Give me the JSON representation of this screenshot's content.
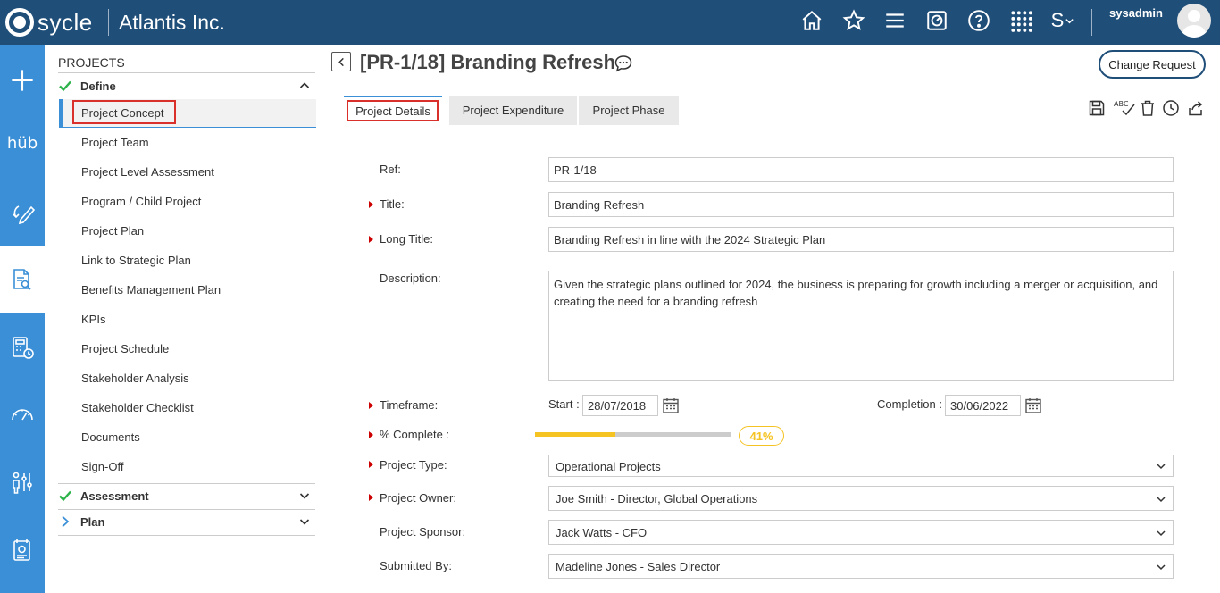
{
  "header": {
    "logo_text": "sycle",
    "company": "Atlantis Inc.",
    "username": "sysadmin",
    "user_initial": "S"
  },
  "sidebar": {
    "title": "PROJECTS",
    "sections": [
      {
        "label": "Define",
        "status": "complete",
        "expanded": true
      },
      {
        "label": "Assessment",
        "status": "complete",
        "expanded": false
      },
      {
        "label": "Plan",
        "status": "pending",
        "expanded": false
      }
    ],
    "define_items": [
      "Project Concept",
      "Project Team",
      "Project Level Assessment",
      "Program / Child Project",
      "Project Plan",
      "Link to Strategic Plan",
      "Benefits Management Plan",
      "KPIs",
      "Project Schedule",
      "Stakeholder Analysis",
      "Stakeholder Checklist",
      "Documents",
      "Sign-Off"
    ],
    "active_item": "Project Concept"
  },
  "main": {
    "title": "[PR-1/18] Branding Refresh",
    "change_request_label": "Change Request",
    "tabs": [
      {
        "label": "Project Details",
        "active": true
      },
      {
        "label": "Project Expenditure",
        "active": false
      },
      {
        "label": "Project Phase",
        "active": false
      }
    ],
    "form": {
      "ref_label": "Ref:",
      "ref_value": "PR-1/18",
      "title_label": "Title:",
      "title_value": "Branding Refresh",
      "long_title_label": "Long Title:",
      "long_title_value": "Branding Refresh in line with the 2024 Strategic Plan",
      "description_label": "Description:",
      "description_value": "Given the strategic plans outlined for 2024, the business is preparing for growth including a merger or acquisition, and creating the need for a branding refresh",
      "timeframe_label": "Timeframe:",
      "start_label": "Start :",
      "start_value": "28/07/2018",
      "completion_label": "Completion :",
      "completion_value": "30/06/2022",
      "complete_label": "% Complete :",
      "complete_value": "41%",
      "complete_fraction": 0.41,
      "project_type_label": "Project Type:",
      "project_type_value": "Operational Projects",
      "project_owner_label": "Project Owner:",
      "project_owner_value": "Joe Smith - Director, Global Operations",
      "project_sponsor_label": "Project Sponsor:",
      "project_sponsor_value": "Jack Watts - CFO",
      "submitted_by_label": "Submitted By:",
      "submitted_by_value": "Madeline Jones - Sales Director"
    }
  },
  "colors": {
    "header_bg": "#1f4e79",
    "rail_bg": "#3a8fd6",
    "required_marker": "#c00000",
    "progress": "#f5c322",
    "highlight_box": "#d9302c",
    "check": "#2db34a"
  },
  "icons": {
    "top": [
      "home-icon",
      "star-icon",
      "menu-icon",
      "dashboard-icon",
      "help-icon",
      "apps-grid-icon",
      "user-menu-icon"
    ],
    "rail": [
      "add-icon",
      "hub-icon",
      "edit-cycle-icon",
      "document-search-icon",
      "calculator-clock-icon",
      "gauge-icon",
      "people-settings-icon",
      "report-icon"
    ],
    "toolbar": [
      "save-icon",
      "spellcheck-icon",
      "delete-icon",
      "history-icon",
      "share-icon"
    ]
  }
}
